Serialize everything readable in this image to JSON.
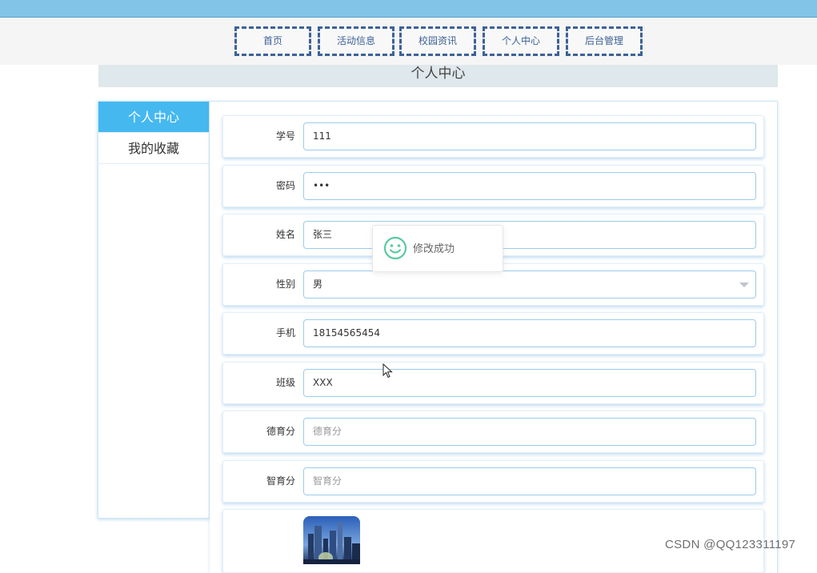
{
  "nav": {
    "items": [
      {
        "label": "首页"
      },
      {
        "label": "活动信息"
      },
      {
        "label": "校园资讯"
      },
      {
        "label": "个人中心"
      },
      {
        "label": "后台管理"
      }
    ]
  },
  "page_title": "个人中心",
  "sidebar": {
    "items": [
      {
        "label": "个人中心",
        "active": true
      },
      {
        "label": "我的收藏",
        "active": false
      }
    ]
  },
  "form": {
    "student_id": {
      "label": "学号",
      "value": "111"
    },
    "password": {
      "label": "密码",
      "value": "•••"
    },
    "name": {
      "label": "姓名",
      "value": "张三"
    },
    "gender": {
      "label": "性别",
      "value": "男"
    },
    "phone": {
      "label": "手机",
      "value": "18154565454"
    },
    "class": {
      "label": "班级",
      "value": "XXX"
    },
    "moral_score": {
      "label": "德育分",
      "placeholder": "德育分"
    },
    "intellect_score": {
      "label": "智育分",
      "placeholder": "智育分"
    }
  },
  "toast": {
    "message": "修改成功",
    "icon": "smile-icon"
  },
  "watermark": "CSDN @QQ123311197",
  "colors": {
    "accent": "#45b8f0",
    "topbar": "#82c4e8",
    "nav_border": "#3d6196",
    "toast_icon": "#5ccaa0"
  }
}
